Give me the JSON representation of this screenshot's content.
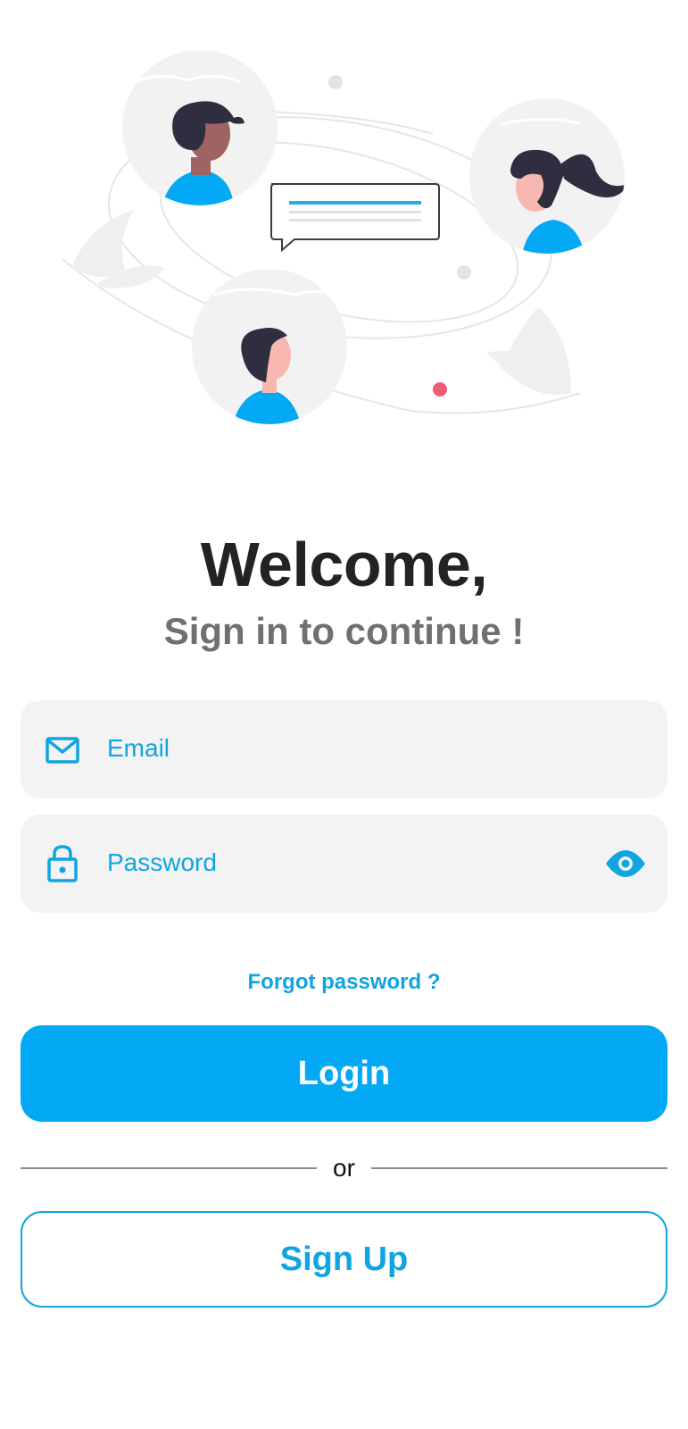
{
  "header": {
    "title": "Welcome,",
    "subtitle": "Sign in to continue !"
  },
  "form": {
    "email": {
      "placeholder": "Email",
      "icon": "mail-icon"
    },
    "password": {
      "placeholder": "Password",
      "icon": "lock-icon",
      "toggle_icon": "eye-icon"
    },
    "forgot_password": "Forgot password ?",
    "login_label": "Login",
    "divider_text": "or",
    "signup_label": "Sign Up"
  },
  "colors": {
    "accent": "#03a9f4",
    "accent_text": "#0ea5e0",
    "field_background": "#f3f3f4",
    "title": "#232323",
    "subtitle": "#707070"
  }
}
